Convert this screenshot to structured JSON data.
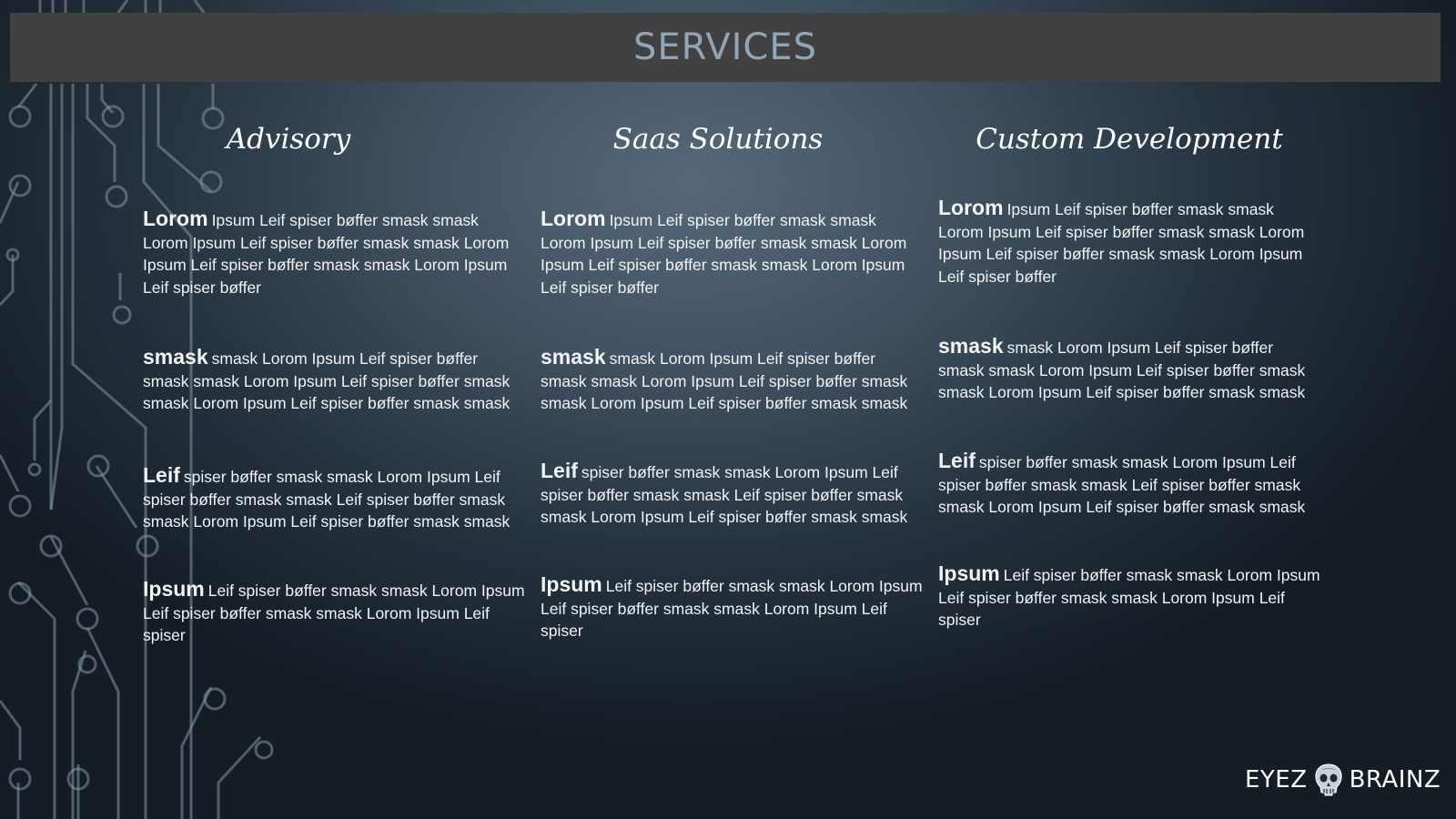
{
  "header": {
    "title": "SERVICES"
  },
  "columns": [
    {
      "heading": "Advisory",
      "paragraphs": [
        {
          "lead": "Lorom",
          "body": "Ipsum Leif spiser bøffer smask smask Lorom Ipsum Leif spiser bøffer smask smask Lorom Ipsum Leif spiser bøffer smask smask Lorom Ipsum Leif spiser bøffer"
        },
        {
          "lead": "smask",
          "body": "smask Lorom Ipsum Leif spiser bøffer smask smask Lorom Ipsum Leif spiser bøffer smask smask Lorom Ipsum Leif spiser bøffer smask smask"
        },
        {
          "lead": "Leif",
          "body": "spiser bøffer smask smask Lorom Ipsum Leif spiser bøffer smask smask Leif spiser bøffer smask smask Lorom Ipsum Leif spiser bøffer smask smask"
        },
        {
          "lead": "Ipsum",
          "body": "Leif spiser bøffer smask smask Lorom Ipsum Leif spiser bøffer smask smask Lorom Ipsum Leif spiser"
        }
      ]
    },
    {
      "heading": "Saas Solutions",
      "paragraphs": [
        {
          "lead": "Lorom",
          "body": "Ipsum Leif spiser bøffer smask smask Lorom Ipsum Leif spiser bøffer smask smask Lorom Ipsum Leif spiser bøffer smask smask Lorom Ipsum Leif spiser bøffer"
        },
        {
          "lead": "smask",
          "body": "smask Lorom Ipsum Leif spiser bøffer smask smask Lorom Ipsum Leif spiser bøffer smask smask Lorom Ipsum Leif spiser bøffer smask smask"
        },
        {
          "lead": "Leif",
          "body": "spiser bøffer smask smask Lorom Ipsum Leif spiser bøffer smask smask Leif spiser bøffer smask smask Lorom Ipsum Leif spiser bøffer smask smask"
        },
        {
          "lead": "Ipsum",
          "body": "Leif spiser bøffer smask smask Lorom Ipsum Leif spiser bøffer smask smask Lorom Ipsum Leif spiser"
        }
      ]
    },
    {
      "heading": "Custom Development",
      "paragraphs": [
        {
          "lead": "Lorom",
          "body": "Ipsum Leif spiser bøffer smask smask Lorom Ipsum Leif spiser bøffer smask smask Lorom Ipsum Leif spiser bøffer smask smask Lorom Ipsum Leif spiser bøffer"
        },
        {
          "lead": "smask",
          "body": "smask Lorom Ipsum Leif spiser bøffer smask smask Lorom Ipsum Leif spiser bøffer smask smask Lorom Ipsum Leif spiser bøffer smask smask"
        },
        {
          "lead": "Leif",
          "body": "spiser bøffer smask smask Lorom Ipsum Leif spiser bøffer smask smask Leif spiser bøffer smask smask Lorom Ipsum Leif spiser bøffer smask smask"
        },
        {
          "lead": "Ipsum",
          "body": "Leif spiser bøffer smask smask Lorom Ipsum Leif spiser bøffer smask smask Lorom Ipsum Leif spiser"
        }
      ]
    }
  ],
  "logo": {
    "left_text": "EYEZ",
    "right_text": "BRAINZ",
    "icon": "skull-icon"
  },
  "colors": {
    "title_bar": "#414141",
    "title_text": "#8fa6b8",
    "body_text": "#f2f4f6",
    "circuit": "#8596a6"
  }
}
